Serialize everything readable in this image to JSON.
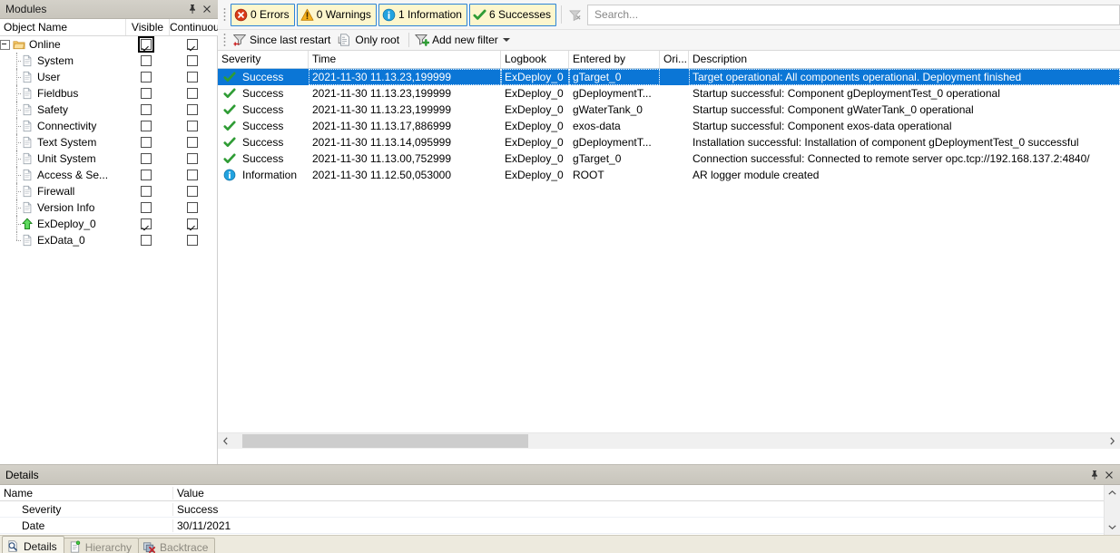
{
  "modules_panel": {
    "title": "Modules",
    "pin_icon": "pin-icon",
    "close_icon": "close-icon",
    "columns": {
      "object_name": "Object Name",
      "visible": "Visible",
      "continuous": "Continuous"
    },
    "rows": [
      {
        "label": "Online",
        "icon": "folder-icon",
        "depth": 0,
        "expander": "minus",
        "visible": true,
        "continuous": true,
        "focused": true
      },
      {
        "label": "System",
        "icon": "document-icon",
        "depth": 1,
        "visible": false,
        "continuous": false
      },
      {
        "label": "User",
        "icon": "document-icon",
        "depth": 1,
        "visible": false,
        "continuous": false
      },
      {
        "label": "Fieldbus",
        "icon": "document-icon",
        "depth": 1,
        "visible": false,
        "continuous": false
      },
      {
        "label": "Safety",
        "icon": "document-icon",
        "depth": 1,
        "visible": false,
        "continuous": false
      },
      {
        "label": "Connectivity",
        "icon": "document-icon",
        "depth": 1,
        "visible": false,
        "continuous": false
      },
      {
        "label": "Text System",
        "icon": "document-icon",
        "depth": 1,
        "visible": false,
        "continuous": false
      },
      {
        "label": "Unit System",
        "icon": "document-icon",
        "depth": 1,
        "visible": false,
        "continuous": false
      },
      {
        "label": "Access & Se...",
        "icon": "document-icon",
        "depth": 1,
        "visible": false,
        "continuous": false
      },
      {
        "label": "Firewall",
        "icon": "document-icon",
        "depth": 1,
        "visible": false,
        "continuous": false
      },
      {
        "label": "Version Info",
        "icon": "document-icon",
        "depth": 1,
        "visible": false,
        "continuous": false
      },
      {
        "label": "ExDeploy_0",
        "icon": "green-arrow-up-icon",
        "depth": 1,
        "visible": true,
        "continuous": true
      },
      {
        "label": "ExData_0",
        "icon": "document-icon",
        "depth": 1,
        "visible": false,
        "continuous": false,
        "last": true
      }
    ]
  },
  "toolbar": {
    "filters": [
      {
        "label": "0 Errors",
        "icon": "error-icon",
        "color": "#d93a17"
      },
      {
        "label": "0 Warnings",
        "icon": "warning-icon",
        "color": "#f3a81a"
      },
      {
        "label": "1 Information",
        "icon": "information-icon",
        "color": "#1b9ede"
      },
      {
        "label": "6 Successes",
        "icon": "success-icon",
        "color": "#2f9c35"
      }
    ],
    "clear_filter_icon": "clear-filter-icon",
    "search": {
      "placeholder": "Search...",
      "value": ""
    },
    "row2": [
      {
        "label": "Since last restart",
        "icon": "filter-restart-icon"
      },
      {
        "label": "Only root",
        "icon": "only-root-icon"
      },
      {
        "label": "Add new filter",
        "icon": "add-filter-icon",
        "has_caret": true
      }
    ]
  },
  "log_grid": {
    "columns": [
      "Severity",
      "Time",
      "Logbook",
      "Entered by",
      "Ori...",
      "Description"
    ],
    "rows": [
      {
        "severity": "Success",
        "severity_icon": "success-icon",
        "time": "2021-11-30 11.13.23,199999",
        "logbook": "ExDeploy_0",
        "entered_by": "gTarget_0",
        "origin": "",
        "description": "Target operational: All components operational. Deployment finished",
        "selected": true
      },
      {
        "severity": "Success",
        "severity_icon": "success-icon",
        "time": "2021-11-30 11.13.23,199999",
        "logbook": "ExDeploy_0",
        "entered_by": "gDeploymentT...",
        "origin": "",
        "description": "Startup successful: Component gDeploymentTest_0 operational",
        "selected": false
      },
      {
        "severity": "Success",
        "severity_icon": "success-icon",
        "time": "2021-11-30 11.13.23,199999",
        "logbook": "ExDeploy_0",
        "entered_by": "gWaterTank_0",
        "origin": "",
        "description": "Startup successful: Component gWaterTank_0 operational",
        "selected": false
      },
      {
        "severity": "Success",
        "severity_icon": "success-icon",
        "time": "2021-11-30 11.13.17,886999",
        "logbook": "ExDeploy_0",
        "entered_by": "exos-data",
        "origin": "",
        "description": "Startup successful: Component exos-data operational",
        "selected": false
      },
      {
        "severity": "Success",
        "severity_icon": "success-icon",
        "time": "2021-11-30 11.13.14,095999",
        "logbook": "ExDeploy_0",
        "entered_by": "gDeploymentT...",
        "origin": "",
        "description": "Installation successful: Installation of component gDeploymentTest_0 successful",
        "selected": false
      },
      {
        "severity": "Success",
        "severity_icon": "success-icon",
        "time": "2021-11-30 11.13.00,752999",
        "logbook": "ExDeploy_0",
        "entered_by": "gTarget_0",
        "origin": "",
        "description": "Connection successful: Connected to remote server opc.tcp://192.168.137.2:4840/",
        "selected": false
      },
      {
        "severity": "Information",
        "severity_icon": "information-icon",
        "time": "2021-11-30 11.12.50,053000",
        "logbook": "ExDeploy_0",
        "entered_by": "ROOT",
        "origin": "",
        "description": "AR logger module created",
        "selected": false
      }
    ]
  },
  "details_panel": {
    "title": "Details",
    "pin_icon": "pin-icon",
    "close_icon": "close-icon",
    "columns": {
      "name": "Name",
      "value": "Value"
    },
    "rows": [
      {
        "name": "Severity",
        "value": "Success"
      },
      {
        "name": "Date",
        "value": "30/11/2021"
      }
    ]
  },
  "tabs": [
    {
      "label": "Details",
      "icon": "details-icon",
      "active": true
    },
    {
      "label": "Hierarchy",
      "icon": "hierarchy-icon",
      "active": false
    },
    {
      "label": "Backtrace",
      "icon": "backtrace-icon",
      "active": false
    }
  ]
}
